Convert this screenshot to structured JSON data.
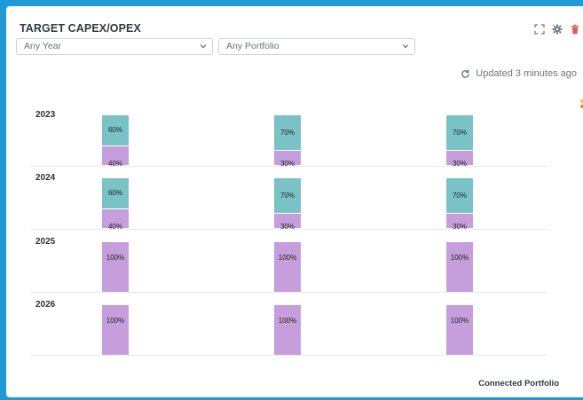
{
  "widget": {
    "title": "TARGET CAPEX/OPEX",
    "filters": [
      {
        "label": "Any Year"
      },
      {
        "label": "Any Portfolio"
      }
    ],
    "updated": "Updated 3 minutes ago",
    "icons": [
      "expand-icon",
      "gear-icon",
      "trash-icon",
      "refresh-icon",
      "color-palette-icon"
    ],
    "colors": {
      "accent": "#1f9ad6",
      "capex": "#79c2c5",
      "opex": "#c69edc",
      "delete": "#e05b5b"
    }
  },
  "chart_data": {
    "type": "bar",
    "orientation": "stacked-100",
    "rows": [
      "2023",
      "2024",
      "2025",
      "2026"
    ],
    "columns": 3,
    "series": [
      {
        "color": "#79c2c5",
        "values": [
          [
            60,
            70,
            70
          ],
          [
            60,
            70,
            70
          ],
          [
            0,
            0,
            0
          ],
          [
            0,
            0,
            0
          ]
        ]
      },
      {
        "color": "#c69edc",
        "values": [
          [
            40,
            30,
            30
          ],
          [
            40,
            30,
            30
          ],
          [
            100,
            100,
            100
          ],
          [
            100,
            100,
            100
          ]
        ]
      }
    ],
    "labels": {
      "2023": [
        [
          "60%",
          "40%"
        ],
        [
          "70%",
          "30%"
        ],
        [
          "70%",
          "30%"
        ]
      ],
      "2024": [
        [
          "60%",
          "40%"
        ],
        [
          "70%",
          "30%"
        ],
        [
          "70%",
          "30%"
        ]
      ],
      "2025": [
        [
          "",
          "100%"
        ],
        [
          "",
          "100%"
        ],
        [
          "",
          "100%"
        ]
      ],
      "2026": [
        [
          "",
          "100%"
        ],
        [
          "",
          "100%"
        ],
        [
          "",
          "100%"
        ]
      ]
    },
    "legend": "Connected Portfolio"
  }
}
